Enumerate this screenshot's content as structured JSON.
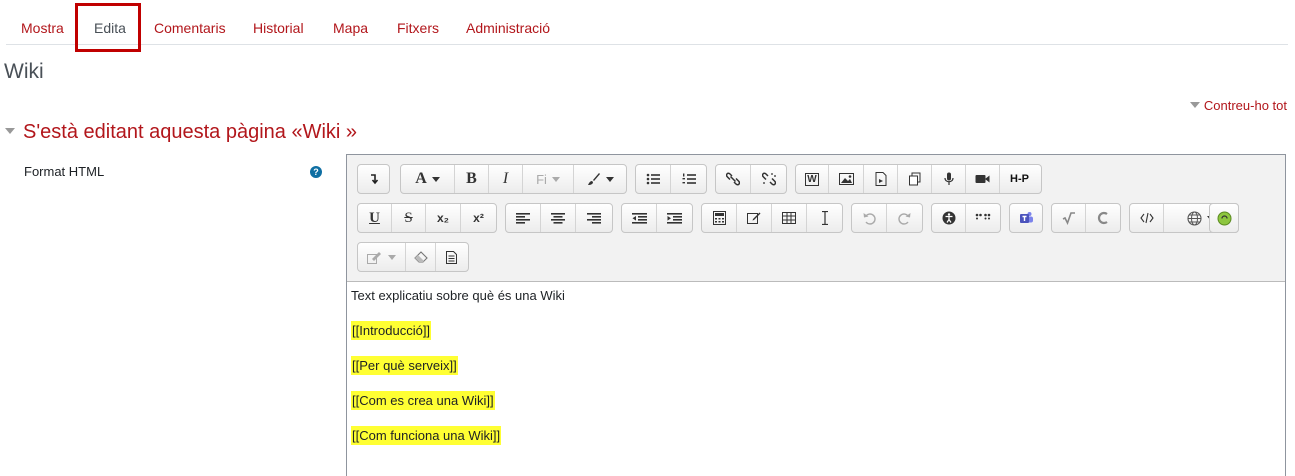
{
  "tabs": [
    {
      "label": "Mostra"
    },
    {
      "label": "Edita"
    },
    {
      "label": "Comentaris"
    },
    {
      "label": "Historial"
    },
    {
      "label": "Mapa"
    },
    {
      "label": "Fitxers"
    },
    {
      "label": "Administració"
    }
  ],
  "active_tab": "Edita",
  "page_title": "Wiki",
  "collapse_all_label": "Contreu-ho tot",
  "section_title": "S'està editant aquesta pàgina «Wiki »",
  "field": {
    "label": "Format HTML",
    "help_icon": "question-circle-icon",
    "help_glyph": "?"
  },
  "toolbar": {
    "font_glyph": "A",
    "bold_glyph": "B",
    "italic_glyph": "I",
    "font_family_glyph": "Fi",
    "underline_glyph": "U",
    "strike_glyph": "S",
    "subscript_glyph": "x₂",
    "superscript_glyph": "x²",
    "word_glyph": "W",
    "h5p_glyph": "H-P"
  },
  "editor": {
    "paragraphs": [
      {
        "text": "Text explicatiu sobre què és una Wiki",
        "highlight": false
      },
      {
        "text": "[[Introducció]] ",
        "highlight": true
      },
      {
        "text": "[[Per què serveix]]",
        "highlight": true
      },
      {
        "text": "[[Com es crea una Wiki]]",
        "highlight": true
      },
      {
        "text": "[[Com funciona una Wiki]]",
        "highlight": true
      }
    ]
  },
  "colors": {
    "link": "#b2161b",
    "highlight": "#ffff33",
    "active_tab_box": "#c00000",
    "help_icon": "#0f6fa3"
  }
}
